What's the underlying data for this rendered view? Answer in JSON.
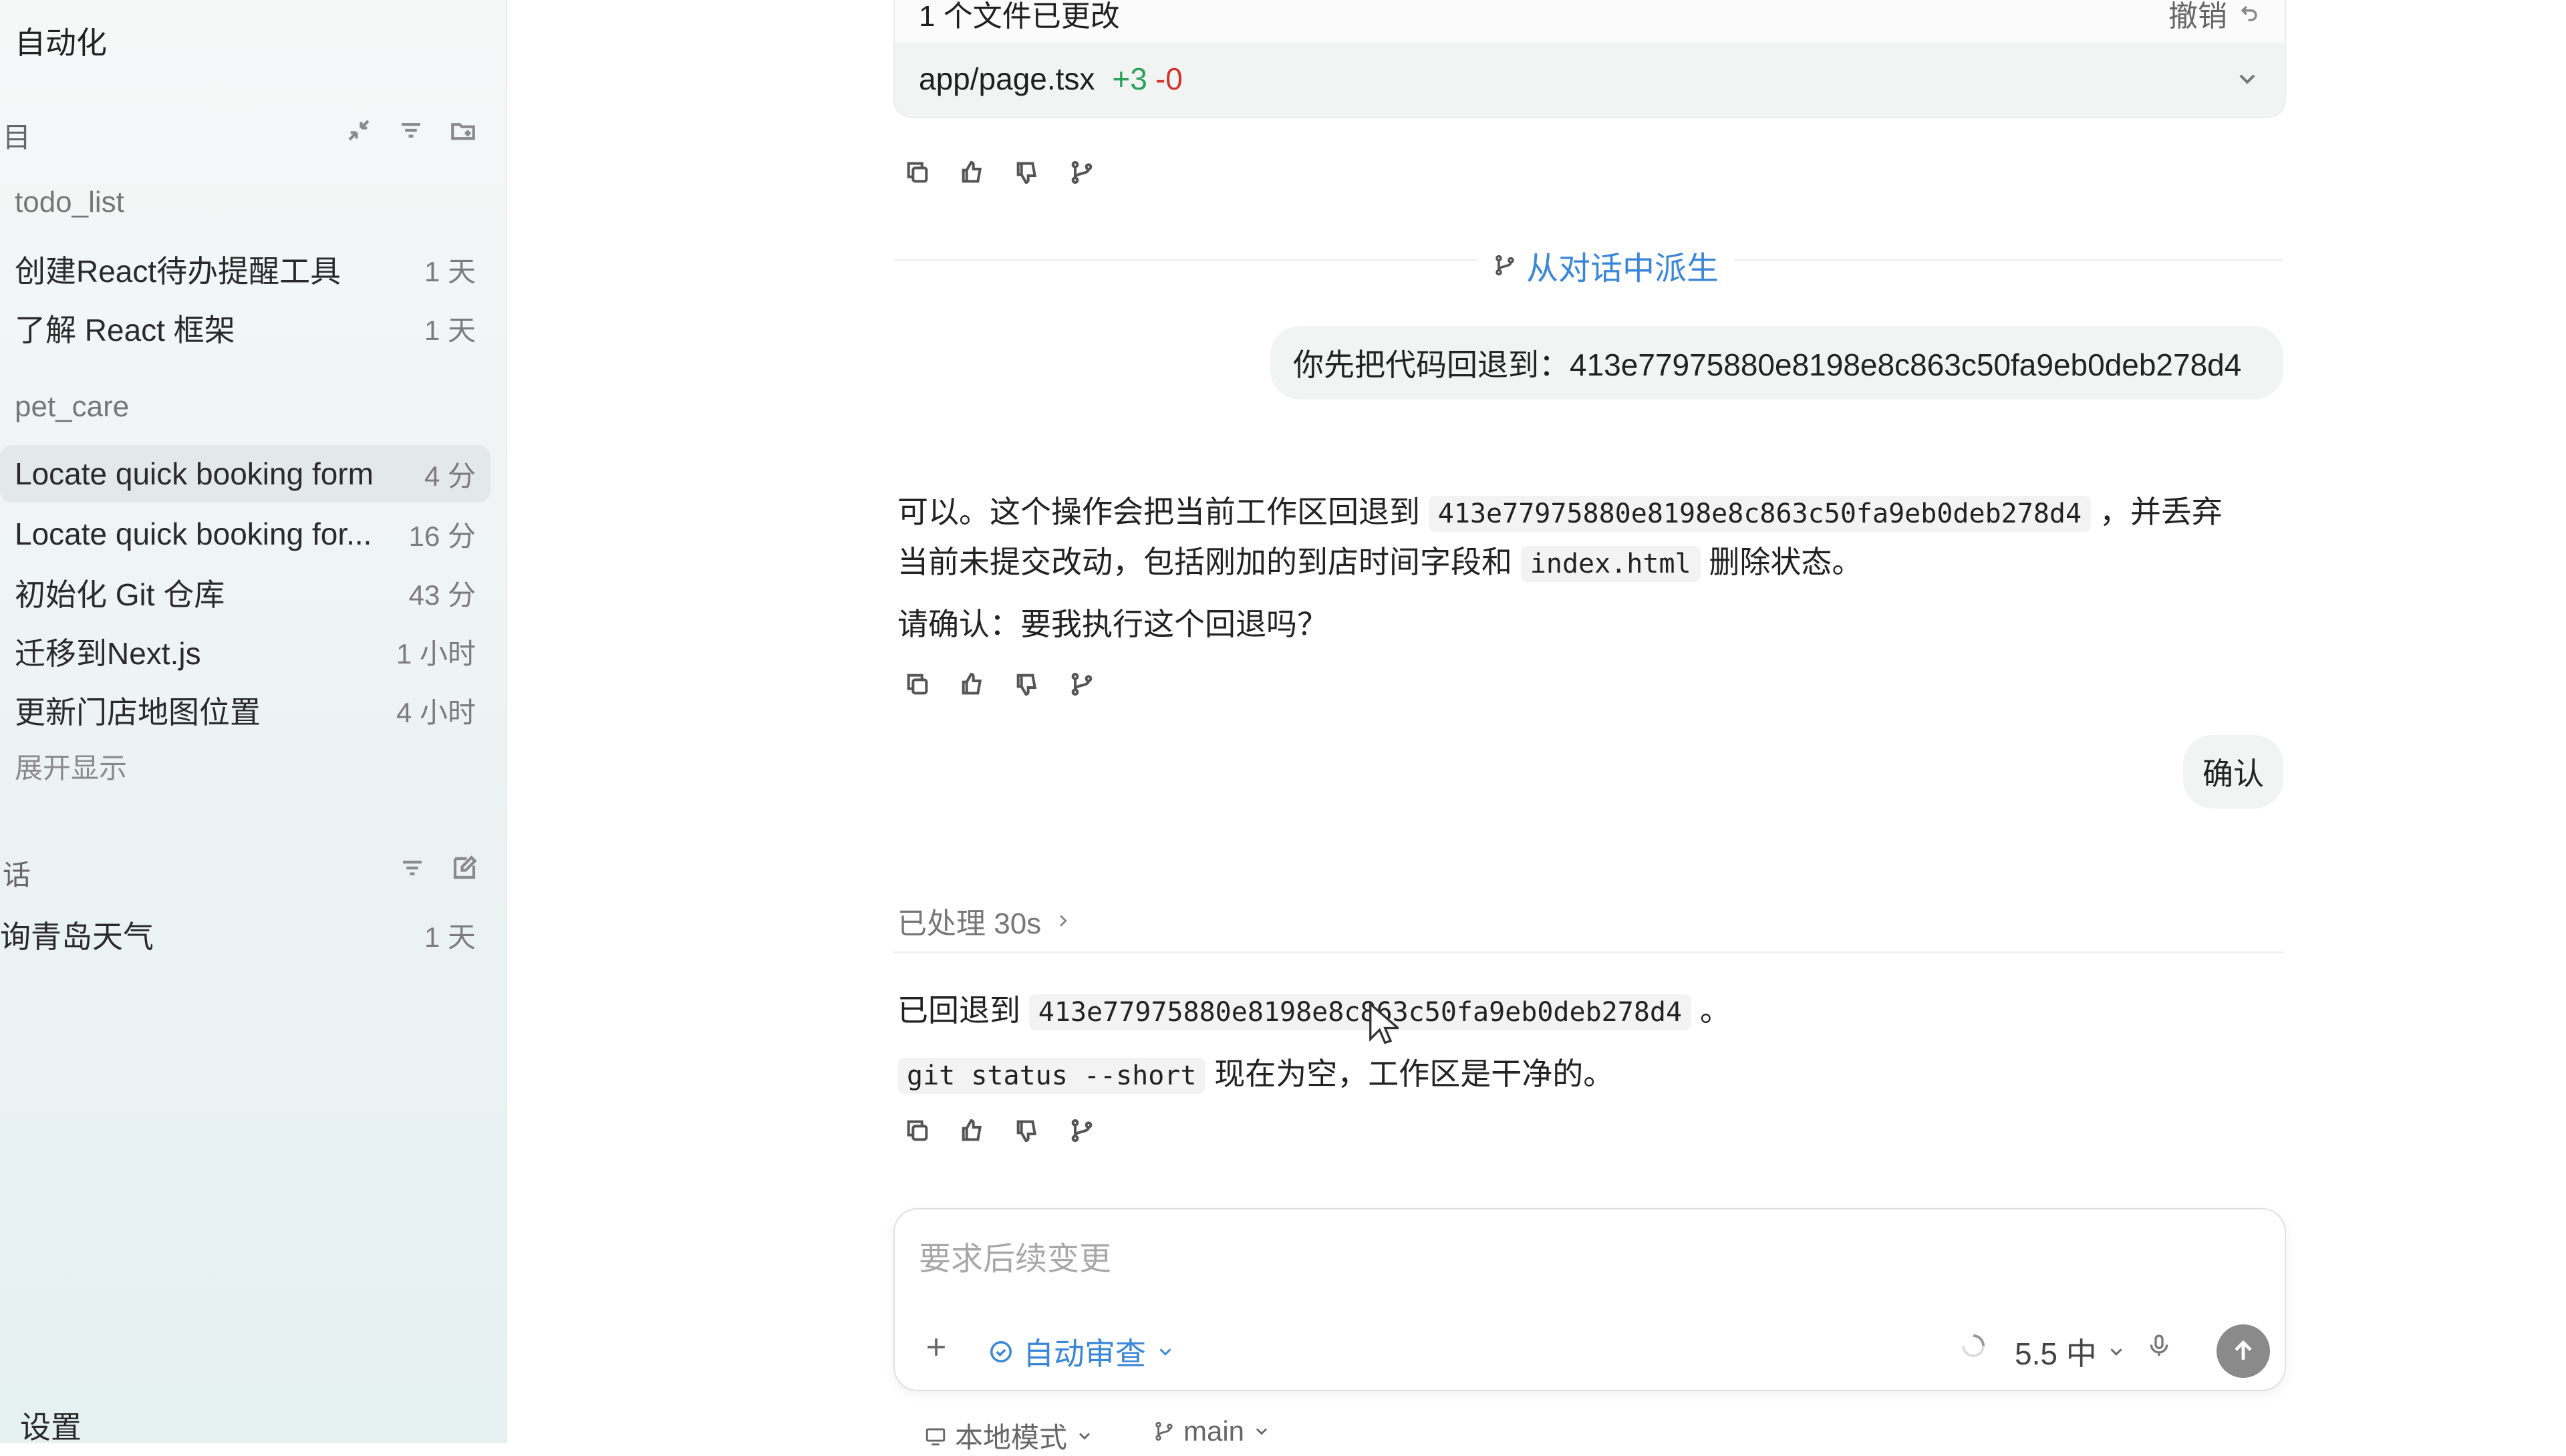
{
  "sidebar": {
    "app_title": "自动化",
    "projects_section": "目",
    "chats_section": "话",
    "groups": [
      {
        "name": "todo_list",
        "items": [
          {
            "title": "创建React待办提醒工具",
            "time": "1 天"
          },
          {
            "title": "了解 React 框架",
            "time": "1 天"
          }
        ]
      },
      {
        "name": "pet_care",
        "items": [
          {
            "title": "Locate quick booking form",
            "time": "4 分",
            "active": true
          },
          {
            "title": "Locate quick booking for...",
            "time": "16 分"
          },
          {
            "title": "初始化 Git 仓库",
            "time": "43 分"
          },
          {
            "title": "迁移到Next.js",
            "time": "1 小时"
          },
          {
            "title": "更新门店地图位置",
            "time": "4 小时"
          }
        ]
      }
    ],
    "expand_label": "展开显示",
    "chat_items": [
      {
        "title": "询青岛天气",
        "time": "1 天"
      }
    ],
    "settings_label": "设置"
  },
  "main": {
    "changes_card": {
      "header": "1 个文件已更改",
      "undo_label": "撤销",
      "file": "app/page.tsx",
      "additions": "+3",
      "deletions": "-0"
    },
    "branch_divider": "从对话中派生",
    "user_msg_1": "你先把代码回退到：413e77975880e8198e8c863c50fa9eb0deb278d4",
    "assistant_1": {
      "p1_a": "可以。这个操作会把当前工作区回退到",
      "p1_code": "413e77975880e8198e8c863c50fa9eb0deb278d4",
      "p1_b": "，并丢弃",
      "p2_a": "当前未提交改动，包括刚加的到店时间字段和",
      "p2_code": "index.html",
      "p2_b": "删除状态。",
      "p3": "请确认：要我执行这个回退吗？"
    },
    "user_msg_2": "确认",
    "processed_label": "已处理 30s",
    "assistant_2": {
      "p1_a": "已回退到",
      "p1_code": "413e77975880e8198e8c863c50fa9eb0deb278d4",
      "p1_b": "。",
      "p2_code": "git status --short",
      "p2_b": "现在为空，工作区是干净的。"
    },
    "composer": {
      "placeholder": "要求后续变更",
      "review_label": "自动审查",
      "model_label": "5.5 中"
    },
    "footer": {
      "mode_label": "本地模式",
      "branch_label": "main"
    }
  },
  "icons": {
    "actions": [
      "copy-icon",
      "thumbs-up-icon",
      "thumbs-down-icon",
      "branch-icon"
    ],
    "accent_color": "#3a86d8",
    "add_color": "#2aa35a",
    "remove_color": "#d0342c"
  }
}
